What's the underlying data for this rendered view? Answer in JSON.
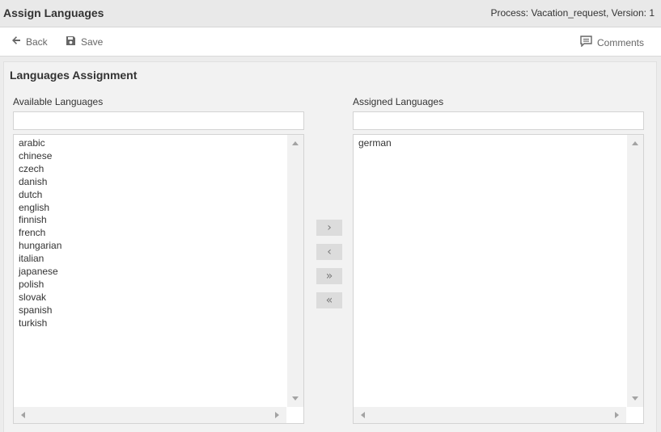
{
  "header": {
    "title": "Assign Languages",
    "process_info": "Process: Vacation_request, Version: 1"
  },
  "toolbar": {
    "back_label": "Back",
    "save_label": "Save",
    "comments_label": "Comments"
  },
  "panel": {
    "title": "Languages Assignment"
  },
  "available": {
    "label": "Available Languages",
    "filter_value": "",
    "items": [
      "arabic",
      "chinese",
      "czech",
      "danish",
      "dutch",
      "english",
      "finnish",
      "french",
      "hungarian",
      "italian",
      "japanese",
      "polish",
      "slovak",
      "spanish",
      "turkish"
    ]
  },
  "assigned": {
    "label": "Assigned Languages",
    "filter_value": "",
    "items": [
      "german"
    ]
  },
  "move_buttons": {
    "add": "›",
    "remove": "‹",
    "add_all": "»",
    "remove_all": "«"
  },
  "icons": {
    "back": "arrow-left-icon",
    "save": "floppy-disk-icon",
    "comments": "comment-icon"
  },
  "colors": {
    "background": "#ececec",
    "toolbar": "#ffffff",
    "button": "#dcdcdc",
    "text": "#333333",
    "muted": "#666666"
  }
}
